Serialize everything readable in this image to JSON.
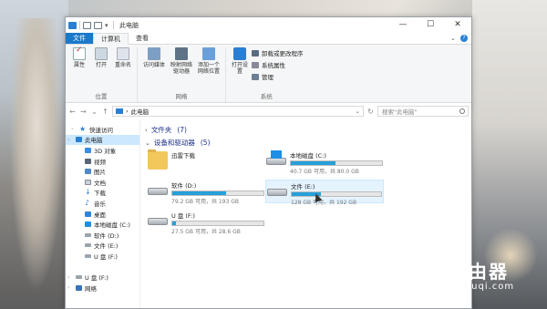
{
  "window": {
    "title": "此电脑",
    "controls": {
      "minimize": "—",
      "maximize": "☐",
      "close": "✕"
    }
  },
  "tabs": [
    {
      "label": "文件",
      "kind": "file"
    },
    {
      "label": "计算机",
      "kind": "active"
    },
    {
      "label": "查看",
      "kind": "normal"
    }
  ],
  "ribbon": {
    "groups": [
      {
        "label": "位置",
        "items": [
          {
            "label": "属性",
            "icon": "properties-icon"
          },
          {
            "label": "打开",
            "icon": "open-icon"
          },
          {
            "label": "重命名",
            "icon": "rename-icon"
          }
        ]
      },
      {
        "label": "网络",
        "items": [
          {
            "label": "访问媒体",
            "icon": "media-icon"
          },
          {
            "label": "映射网络驱动器",
            "icon": "network-drive-icon"
          },
          {
            "label": "添加一个网络位置",
            "icon": "network-location-icon"
          }
        ]
      },
      {
        "label": "系统",
        "items": [
          {
            "label": "打开设置",
            "icon": "settings-icon"
          }
        ],
        "small": [
          {
            "label": "卸载或更改程序",
            "icon": "uninstall-icon"
          },
          {
            "label": "系统属性",
            "icon": "system-properties-icon"
          },
          {
            "label": "管理",
            "icon": "manage-icon"
          }
        ]
      }
    ]
  },
  "address": {
    "path": "此电脑",
    "search_placeholder": "搜索\"此电脑\""
  },
  "nav": {
    "items": [
      {
        "label": "快速访问",
        "icon": "star-icon",
        "indent": 1
      },
      {
        "label": "此电脑",
        "icon": "pc-icon",
        "indent": 0,
        "selected": true
      },
      {
        "label": "3D 对象",
        "icon": "3d-objects-icon",
        "indent": 2
      },
      {
        "label": "视频",
        "icon": "video-icon",
        "indent": 2
      },
      {
        "label": "图片",
        "icon": "pictures-icon",
        "indent": 2
      },
      {
        "label": "文档",
        "icon": "documents-icon",
        "indent": 2
      },
      {
        "label": "下载",
        "icon": "download-icon",
        "indent": 2
      },
      {
        "label": "音乐",
        "icon": "music-icon",
        "indent": 2
      },
      {
        "label": "桌面",
        "icon": "desktop-icon",
        "indent": 2
      },
      {
        "label": "本地磁盘 (C:)",
        "icon": "windows-drive-icon",
        "indent": 2
      },
      {
        "label": "软件 (D:)",
        "icon": "drive-icon",
        "indent": 2
      },
      {
        "label": "文件 (E:)",
        "icon": "drive-icon",
        "indent": 2
      },
      {
        "label": "U 盘 (F:)",
        "icon": "drive-icon",
        "indent": 2
      },
      {
        "label": "",
        "icon": "",
        "indent": 0
      },
      {
        "label": "U 盘 (F:)",
        "icon": "drive-icon",
        "indent": 0
      },
      {
        "label": "网络",
        "icon": "network-icon",
        "indent": 0
      }
    ]
  },
  "content": {
    "folders_section": {
      "label": "文件夹",
      "count": "(7)"
    },
    "devices_section": {
      "label": "设备和驱动器",
      "count": "(5)"
    },
    "devices": [
      {
        "name": "迅雷下载",
        "type": "folder",
        "size": "",
        "fill": null,
        "selected": false
      },
      {
        "name": "本地磁盘 (C:)",
        "type": "windows-drive",
        "size": "40.7 GB 可用，共 80.0 GB",
        "fill": 0.49,
        "selected": false
      },
      {
        "name": "软件 (D:)",
        "type": "drive",
        "size": "79.2 GB 可用，共 193 GB",
        "fill": 0.59,
        "selected": false
      },
      {
        "name": "文件 (E:)",
        "type": "drive",
        "size": "128 GB 可用，共 192 GB",
        "fill": 0.33,
        "selected": true
      },
      {
        "name": "U 盘 (F:)",
        "type": "drive",
        "size": "27.5 GB 可用，共 28.6 GB",
        "fill": 0.04,
        "selected": false
      }
    ]
  },
  "watermark": {
    "cn": "路由器",
    "en": "luyouqi.com"
  },
  "colors": {
    "accent": "#1979ca",
    "bar_fill": "#26a0da",
    "selection": "#cce8ff"
  }
}
